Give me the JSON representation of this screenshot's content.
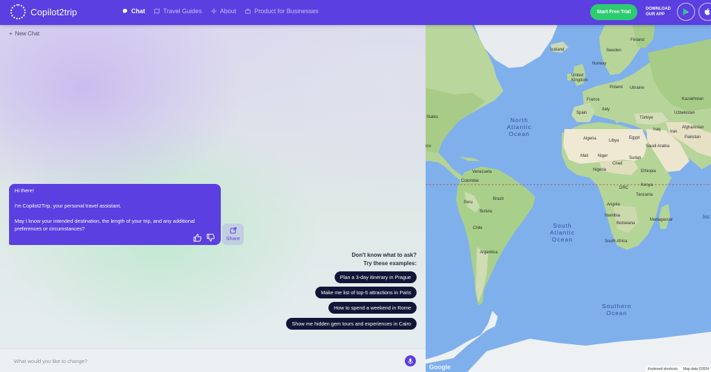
{
  "header": {
    "brand": "Copilot2trip",
    "nav": [
      {
        "label": "Chat",
        "icon": "chat-bubble-icon",
        "active": true
      },
      {
        "label": "Travel Guides",
        "icon": "map-icon",
        "active": false
      },
      {
        "label": "About",
        "icon": "sun-icon",
        "active": false
      },
      {
        "label": "Product for Businesses",
        "icon": "briefcase-icon",
        "active": false
      }
    ],
    "cta_label": "Start Free Trial",
    "download_line1": "DOWNLOAD",
    "download_line2": "OUR APP",
    "stores": [
      "google-play-icon",
      "apple-icon"
    ]
  },
  "chat": {
    "new_chat_label": "New Chat",
    "message": {
      "greeting": "Hi there!",
      "intro": "I'm Copilot2Trip, your personal travel assistant.",
      "question": "May I know your intended destination, the length of your trip, and any additional preferences or circumstances?"
    },
    "share_label": "Share",
    "examples_title_line1": "Don't know what to ask?",
    "examples_title_line2": "Try these examples:",
    "examples": [
      "Plan a 3-day itinerary in Prague",
      "Make me list of top-5 attractions in Paris",
      "How to spend a weekend in Rome",
      "Show me hidden gem tours and experiences in Cairo"
    ],
    "input_placeholder": "What would you like to change?"
  },
  "map": {
    "oceans": {
      "north_atlantic": [
        "North",
        "Atlantic",
        "Ocean"
      ],
      "south_atlantic": [
        "South",
        "Atlantic",
        "Ocean"
      ],
      "southern": [
        "Southern",
        "Ocean"
      ]
    },
    "labels": {
      "finland": "Finland",
      "iceland": "Iceland",
      "sweden": "Sweden",
      "norway": "Norway",
      "uk": "United Kingdom",
      "poland": "Poland",
      "ukraine": "Ukraine",
      "france": "France",
      "spain": "Spain",
      "italy": "Italy",
      "turkiye": "Türkiye",
      "kazakhstan": "Kazakhstan",
      "uzbekistan": "Uzbekistan",
      "iraq": "Iraq",
      "iran": "Iran",
      "afghanistan": "Afghanistan",
      "pakistan": "Pakistan",
      "algeria": "Algeria",
      "libya": "Libya",
      "egypt": "Egypt",
      "saudi": "Saudi Arabia",
      "mali": "Mali",
      "niger": "Niger",
      "sudan": "Sudan",
      "chad": "Chad",
      "nigeria": "Nigeria",
      "ethiopia": "Ethiopia",
      "drc": "DRC",
      "kenya": "Kenya",
      "tanzania": "Tanzania",
      "angola": "Angola",
      "namibia": "Namibia",
      "botswana": "Botswana",
      "madagascar": "Madagascar",
      "south_africa": "South Africa",
      "states": "States",
      "mexico": "ico",
      "venezuela": "Venezuela",
      "colombia": "Colombia",
      "peru": "Peru",
      "brazil": "Brazil",
      "bolivia": "Bolivia",
      "chile": "Chile",
      "argentina": "Argentina",
      "right_edge": "Inc"
    },
    "google_label": "Google",
    "keyboard_shortcuts": "Keyboard shortcuts",
    "map_data": "Map data ©2024"
  },
  "colors": {
    "brand_purple": "#5b3fe0",
    "cta_green": "#2ecc71",
    "chip_dark": "#111637",
    "water": "#7fb0ec"
  }
}
